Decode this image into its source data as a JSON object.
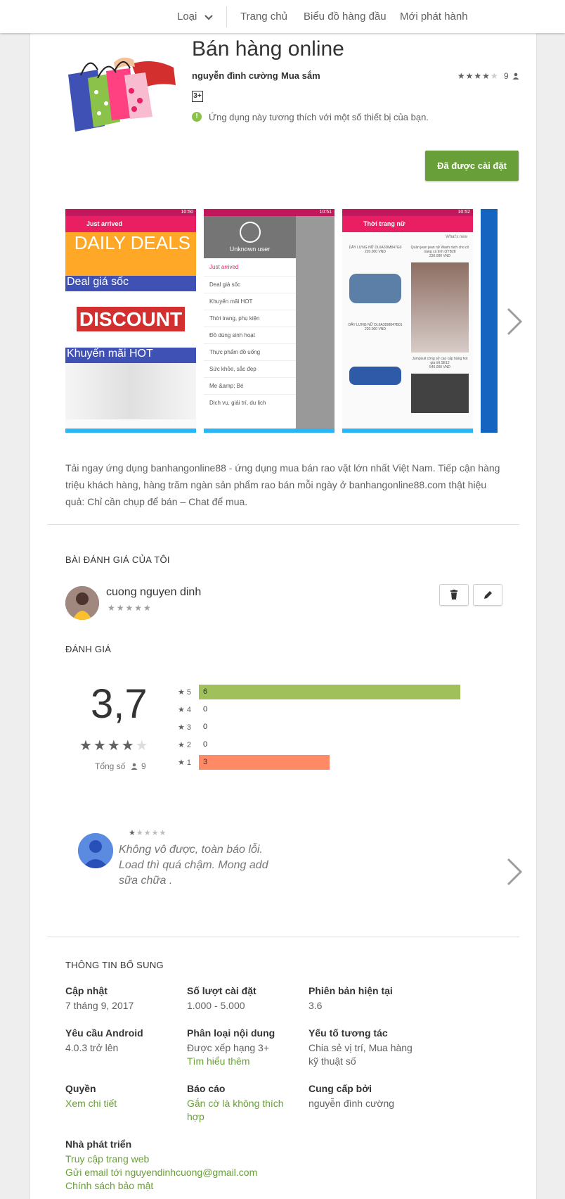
{
  "nav": {
    "category": "Loại",
    "home": "Trang chủ",
    "top_charts": "Biểu đồ hàng đầu",
    "new_releases": "Mới phát hành"
  },
  "app": {
    "title": "Bán hàng online",
    "developer": "nguyễn đình cường",
    "category": "Mua sắm",
    "rating_count": "9",
    "content_rating": "3+",
    "compat_note": "Ứng dụng này tương thích với một số thiết bị của bạn.",
    "install_label": "Đã được cài đặt"
  },
  "screenshots": [
    {
      "toolbar": "Just arrived",
      "time": "10:50",
      "lines": [
        "DAILY DEALS",
        "Deal giá sốc",
        "DISCOUNT",
        "Khuyến mãi HOT"
      ]
    },
    {
      "user": "Unknown user",
      "time": "10:51",
      "menu": [
        "Just arrived",
        "Deal giá sốc",
        "Khuyến mãi HOT",
        "Thời trang, phụ kiện",
        "Đồ dùng sinh hoạt",
        "Thực phẩm đồ uống",
        "Sức khỏe, sắc đẹp",
        "Mẹ &amp; Bé",
        "Dịch vụ, giải trí, du lịch"
      ]
    },
    {
      "toolbar": "Thời trang nữ",
      "time": "10:52",
      "sort": "What's new",
      "products": [
        "DÂY LƯNG NỮ DL6A3DM847G0",
        "220.000 VND",
        "DÂY LƯNG NỮ DL6A3DM847B01",
        "220.000 VND",
        "Jumpsuit công sở cao cấp hàng hot giá tốt SE12",
        "540.000 VND",
        "Quần jean jean nữ Wash rách cho cô nàng cá tính QYB28",
        "230.000 VND"
      ]
    }
  ],
  "description": "Tải ngay ứng dụng banhangonline88 - ứng dụng mua bán rao vặt lớn nhất Việt Nam. Tiếp cận hàng triệu khách hàng, hàng trăm ngàn sản phẩm rao bán mỗi ngày ở banhangonline88.com thật hiệu quả: Chỉ cần chụp để bán – Chat để mua.",
  "my_review": {
    "heading": "BÀI ĐÁNH GIÁ CỦA TÔI",
    "user": "cuong nguyen dinh",
    "stars": "★★★★★"
  },
  "ratings": {
    "heading": "ĐÁNH GIÁ",
    "score": "3,7",
    "score_value": 3.7,
    "total_label": "Tổng số",
    "total": "9",
    "bars": [
      {
        "star": "5",
        "count": "6",
        "value": 6,
        "color": "#9fc05a"
      },
      {
        "star": "4",
        "count": "0",
        "value": 0,
        "color": "#9fc05a"
      },
      {
        "star": "3",
        "count": "0",
        "value": 0,
        "color": "#9fc05a"
      },
      {
        "star": "2",
        "count": "0",
        "value": 0,
        "color": "#9fc05a"
      },
      {
        "star": "1",
        "count": "3",
        "value": 3,
        "color": "#ff8a65"
      }
    ]
  },
  "review": {
    "stars": 1,
    "text": "Không vô được, toàn báo lỗi. Load thì quá chậm. Mong add sữa chữa ."
  },
  "additional": {
    "heading": "THÔNG TIN BỔ SUNG",
    "updated_label": "Cập nhật",
    "updated": "7 tháng 9, 2017",
    "installs_label": "Số lượt cài đặt",
    "installs": "1.000 - 5.000",
    "version_label": "Phiên bản hiện tại",
    "version": "3.6",
    "android_label": "Yêu cầu Android",
    "android": "4.0.3 trở lên",
    "content_label": "Phân loại nội dung",
    "content": "Được xếp hạng 3+",
    "learn_more": "Tìm hiểu thêm",
    "interactive_label": "Yếu tố tương tác",
    "interactive": "Chia sẻ vị trí, Mua hàng kỹ thuật số",
    "perm_label": "Quyền",
    "perm_link": "Xem chi tiết",
    "report_label": "Báo cáo",
    "report_link": "Gắn cờ là không thích hợp",
    "offered_label": "Cung cấp bởi",
    "offered": "nguyễn đình cường",
    "dev_label": "Nhà phát triển",
    "dev_web": "Truy cập trang web",
    "dev_email": "Gửi email tới nguyendinhcuong@gmail.com",
    "dev_privacy": "Chính sách bảo mật"
  },
  "colors": {
    "accent": "#689f38",
    "pink": "#e91e63",
    "bar_green": "#9fc05a",
    "bar_orange": "#ff8a65"
  }
}
